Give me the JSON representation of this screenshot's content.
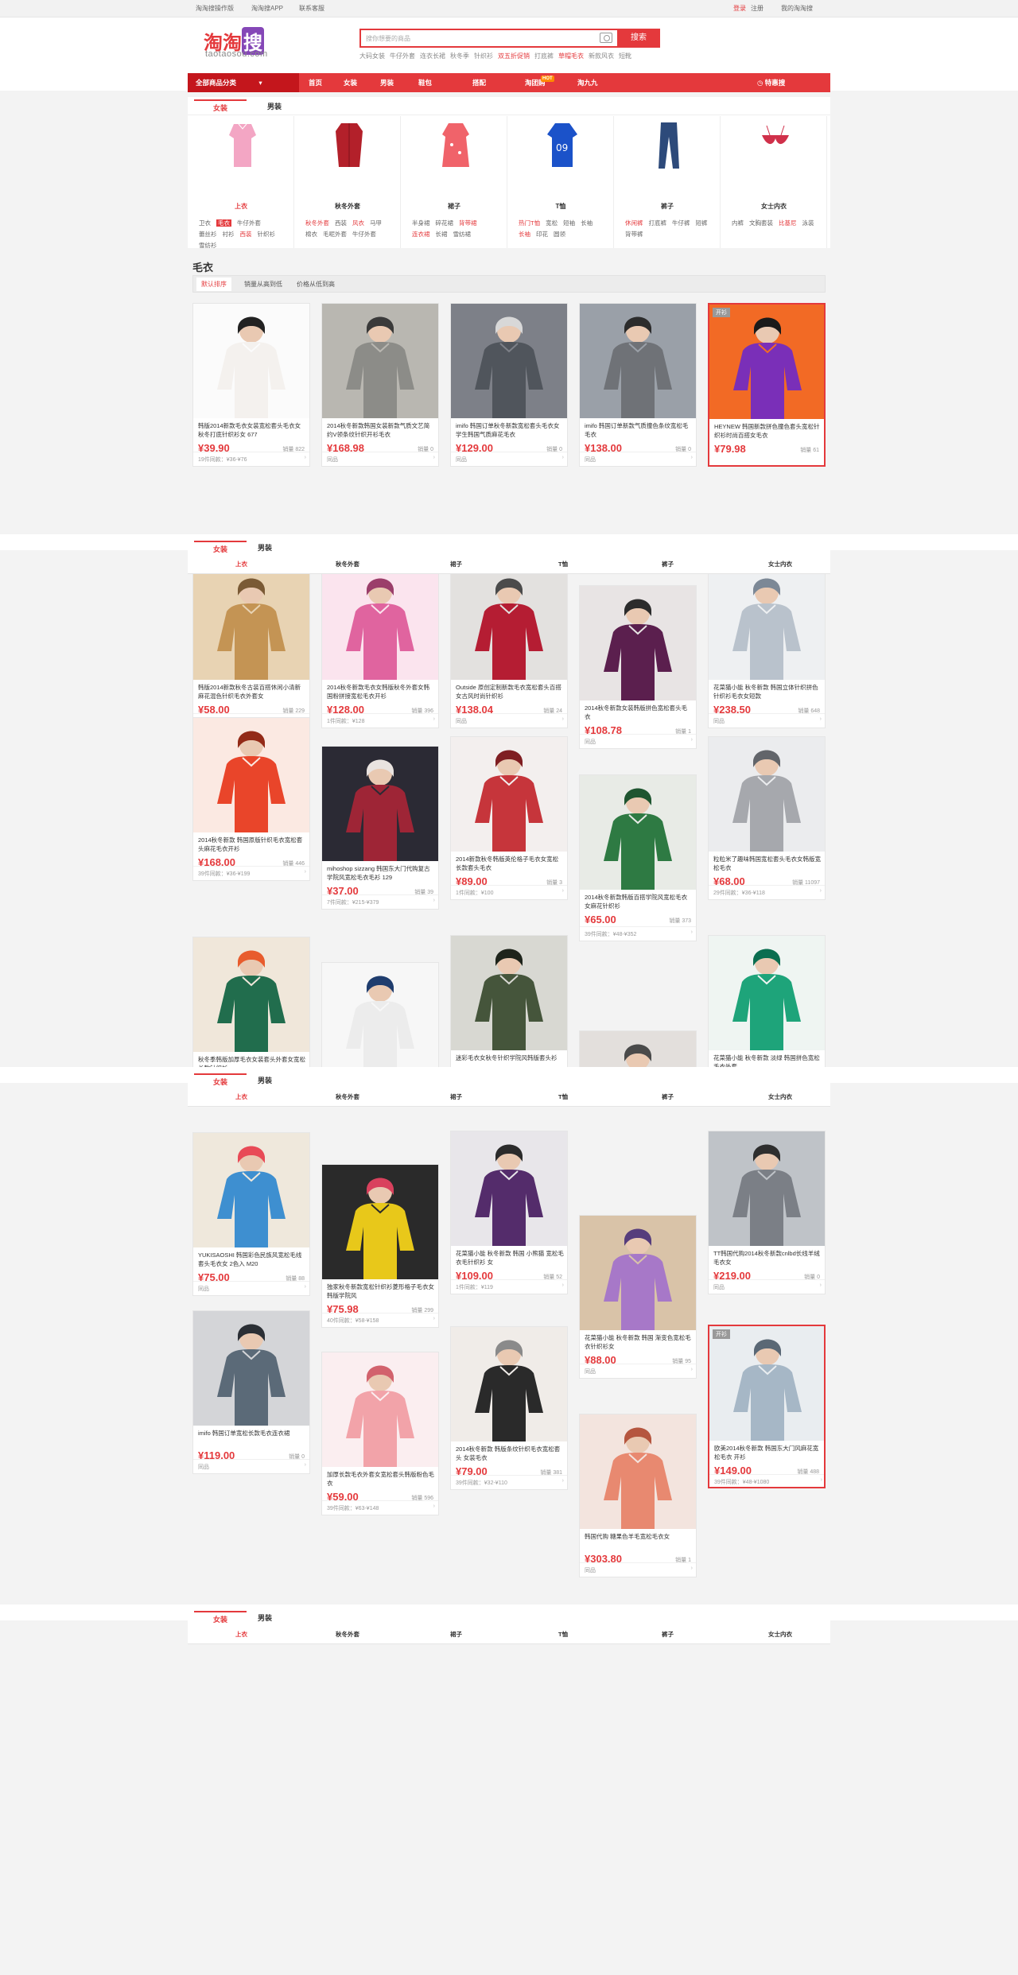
{
  "topbar": {
    "links": [
      "淘淘搜操作版",
      "淘淘搜APP",
      "联系客服"
    ],
    "login": "登录",
    "register": "注册",
    "my": "我的淘淘搜"
  },
  "logo": {
    "cn1": "淘淘",
    "cn2": "搜",
    "en": "taotaosou.com"
  },
  "search": {
    "placeholder": "搜你想要的商品",
    "button": "搜索"
  },
  "hotwords": [
    "大码女装",
    "牛仔外套",
    "连衣长裙",
    "秋冬季",
    "针织衫",
    "双五折促销",
    "打底裤",
    "草帽毛衣",
    "新款风衣",
    "短靴"
  ],
  "nav": {
    "all": "全部商品分类",
    "items": [
      "首页",
      "女装",
      "男装",
      "鞋包",
      "搭配",
      "淘团购",
      "淘九九"
    ],
    "hot": "HOT",
    "fav": "特惠搜"
  },
  "tabs": [
    "女装",
    "男装"
  ],
  "categories": [
    {
      "name": "上衣",
      "subs": [
        "卫衣",
        "毛衣",
        "牛仔外套",
        "蕾丝衫",
        "衬衫",
        "西装",
        "针织衫",
        "雪纺衫"
      ]
    },
    {
      "name": "秋冬外套",
      "subs": [
        "秋冬外套",
        "西装",
        "风衣",
        "马甲",
        "棉衣",
        "毛呢外套",
        "牛仔外套"
      ]
    },
    {
      "name": "裙子",
      "subs": [
        "半身裙",
        "碎花裙",
        "背带裙",
        "连衣裙",
        "长裙",
        "雪纺裙"
      ]
    },
    {
      "name": "T恤",
      "subs": [
        "热门T恤",
        "宽松",
        "短袖",
        "长袖",
        "长袖",
        "印花",
        "圆领"
      ]
    },
    {
      "name": "裤子",
      "subs": [
        "休闲裤",
        "打底裤",
        "牛仔裤",
        "短裤",
        "背带裤"
      ]
    },
    {
      "name": "女士内衣",
      "subs": [
        "内裤",
        "文胸套装",
        "比基尼",
        "泳装"
      ]
    }
  ],
  "section": {
    "title": "毛衣",
    "sorts": [
      "默认排序",
      "销量从高到低",
      "价格从低到高"
    ]
  },
  "sticky": {
    "labels": [
      "上衣",
      "秋冬外套",
      "裙子",
      "T恤",
      "裤子",
      "女士内衣"
    ]
  },
  "products": [
    {
      "title": "韩版2014新款毛衣女装宽松套头毛衣女秋冬打底针织衫女 677",
      "price": "¥39.90",
      "sales": "销量 822",
      "foot": "19件同款：¥36-¥76"
    },
    {
      "title": "2014秋冬新款韩国女装新款气质文艺简约V领条纹针织开衫毛衣",
      "price": "¥168.98",
      "sales": "销量 0",
      "foot": "同品"
    },
    {
      "title": "imifo 韩国订单秋冬新款宽松套头毛衣女学生韩国气质麻花毛衣",
      "price": "¥129.00",
      "sales": "销量 0",
      "foot": "同品"
    },
    {
      "title": "imifo 韩国订单新款气质撞色条纹宽松毛毛衣",
      "price": "¥138.00",
      "sales": "销量 0",
      "foot": "同品"
    },
    {
      "title": "HEYNEW 韩国新款拼色撞色套头宽松针织衫时尚百搭女毛衣",
      "price": "¥79.98",
      "sales": "销量 61",
      "foot": "",
      "tag": "开衫"
    },
    {
      "title": "韩版2014新款秋冬古装百搭休闲小清新麻花混色针织毛衣外套女",
      "price": "¥58.00",
      "sales": "销量 229",
      "foot": "34件同款：¥49-¥235"
    },
    {
      "title": "2014秋冬新款毛衣女韩版秋冬外套女韩国粉拼接宽松毛衣开衫",
      "price": "¥128.00",
      "sales": "销量 396",
      "foot": "1件同款：¥128"
    },
    {
      "title": "Outside 原创定制新款毛衣宽松套头百搭女古风时尚针织衫",
      "price": "¥138.04",
      "sales": "销量 24",
      "foot": "同品"
    },
    {
      "title": "2014秋冬新款女装韩版拼色宽松套头毛衣",
      "price": "¥108.78",
      "sales": "销量 1",
      "foot": "同品"
    },
    {
      "title": "花菜猫小能 秋冬新款 韩国立体针织拼色针织衫毛衣女短款",
      "price": "¥238.50",
      "sales": "销量 648",
      "foot": "同品"
    },
    {
      "title": "2014秋冬新款 韩国原版针织毛衣宽松套头麻花毛衣开衫",
      "price": "¥168.00",
      "sales": "销量 446",
      "foot": "39件同款：¥36-¥199"
    },
    {
      "title": "mihoshop sizzang 韩国东大门代购复古学院风宽松毛衣毛衫 129",
      "price": "¥37.00",
      "sales": "销量 39",
      "foot": "7件同款：¥215-¥379"
    },
    {
      "title": "2014新款秋冬韩版英伦格子毛衣女宽松长款套头毛衣",
      "price": "¥89.00",
      "sales": "销量 3",
      "foot": "1件同款：¥100"
    },
    {
      "title": "2014秋冬新款韩版百搭学院风宽松毛衣女麻花针织衫",
      "price": "¥65.00",
      "sales": "销量 373",
      "foot": "39件同款：¥48-¥352"
    },
    {
      "title": "粒粒米了趣味韩国宽松套头毛衣女韩版宽松毛衣",
      "price": "¥68.00",
      "sales": "销量 11097",
      "foot": "29件同款：¥36-¥118"
    },
    {
      "title": "秋冬季韩版加厚毛衣女装套头外套女宽松长款针织衫",
      "price": "",
      "sales": "",
      "foot": ""
    },
    {
      "title": "",
      "price": "",
      "sales": "",
      "foot": ""
    },
    {
      "title": "迷彩毛衣女秋冬针织学院风韩版套头衫",
      "price": "",
      "sales": "",
      "foot": ""
    },
    {
      "title": "",
      "price": "",
      "sales": "",
      "foot": ""
    },
    {
      "title": "花菜猫小能 秋冬新款 淡绿 韩国拼色宽松毛衣外套",
      "price": "",
      "sales": "",
      "foot": ""
    },
    {
      "title": "YUKISAOSHI 韩国彩色民族风宽松毛线套头毛衣女 2色入 M20",
      "price": "¥75.00",
      "sales": "销量 88",
      "foot": "同品"
    },
    {
      "title": "独家秋冬新款宽松针织衫菱形格子毛衣女韩版学院风",
      "price": "¥75.98",
      "sales": "销量 299",
      "foot": "40件同款：¥58-¥158"
    },
    {
      "title": "花菜猫小能 秋冬新款 韩国 小熊猫 宽松毛衣毛针织衫 女",
      "price": "¥109.00",
      "sales": "销量 52",
      "foot": "1件同款：¥119"
    },
    {
      "title": "花菜猫小能 秋冬新款 韩国 渐变色宽松毛衣针织衫女",
      "price": "¥88.00",
      "sales": "销量 95",
      "foot": "同品"
    },
    {
      "title": "TT韩国代购2014秋冬新款cnlbd长线羊绒毛衣女",
      "price": "¥219.00",
      "sales": "销量 0",
      "foot": "同品"
    },
    {
      "title": "imifo 韩国订单宽松长款毛衣连衣裙",
      "price": "¥119.00",
      "sales": "销量 0",
      "foot": "同品"
    },
    {
      "title": "加厚长款毛衣外套女宽松套头韩版粉色毛衣",
      "price": "¥59.00",
      "sales": "销量 596",
      "foot": "39件同款：¥63-¥148"
    },
    {
      "title": "2014秋冬新款 韩版条纹针织毛衣宽松套头 女装毛衣",
      "price": "¥79.00",
      "sales": "销量 381",
      "foot": "39件同款：¥32-¥110"
    },
    {
      "title": "韩国代购 糖果色羊毛宽松毛衣女",
      "price": "¥303.80",
      "sales": "销量 1",
      "foot": "同品"
    },
    {
      "title": "欧美2014秋冬新款 韩国东大门风麻花宽松毛衣 开衫",
      "price": "¥149.00",
      "sales": "销量 488",
      "foot": "39件同款：¥48-¥1080",
      "tag": "开衫"
    }
  ]
}
